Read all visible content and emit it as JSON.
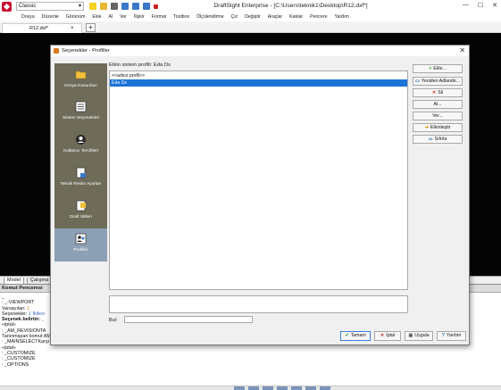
{
  "app": {
    "title": "DraftSight Enterprise - [C:\\Users\\teknik1\\Desktop\\R12.dxf*]",
    "workspace": "Classic",
    "window_controls": [
      "—",
      "☐",
      "✕"
    ]
  },
  "menu": {
    "items": [
      "Dosya",
      "Düzenle",
      "Görünüm",
      "Ekle",
      "Al",
      "Ver",
      "İlişkir",
      "Format",
      "Toolbox",
      "Ölçülendirme",
      "Çiz",
      "Değiştir",
      "Araçlar",
      "Katılar",
      "Pencere",
      "Yardım"
    ]
  },
  "tabs": {
    "document": "R12.dxf*",
    "close": "×",
    "new": "+"
  },
  "layout_tabs": {
    "model": "Model",
    "sheet": "Çalışma"
  },
  "command_window": {
    "title": "Komut Penceresi",
    "lines": [
      {
        "text": "_",
        "bold": false
      },
      {
        "text": ": _-VIEWPORT",
        "bold": false
      },
      {
        "text": "Varsayılan: ",
        "bold": false,
        "hl": "1"
      },
      {
        "text": "Seçenekler: ",
        "bold": false,
        "blue": "1 İkilesi"
      },
      {
        "text": "Seçenek belirtin: _",
        "bold": true
      },
      {
        "text": "«iptal»",
        "bold": false
      },
      {
        "text": "",
        "bold": false
      },
      {
        "text": ": _AM_REVISIONTA",
        "bold": false
      },
      {
        "text": "Tanınmayan komut AM_REVISIONTABLE: Yardım için, F1 düğsine basın.",
        "bold": false
      },
      {
        "text": ": _MAINSELECTKarşı köşeyi belirleyin.«iptal»",
        "bold": false
      },
      {
        "text": "«iptal»",
        "bold": false
      },
      {
        "text": ": _CUSTOMIZE",
        "bold": false
      },
      {
        "text": ": _CUSTOMIZE",
        "bold": false
      },
      {
        "text": "",
        "bold": false
      },
      {
        "text": ": _OPTIONS",
        "bold": false
      }
    ]
  },
  "dialog": {
    "title": "Seçenekler - Profiller",
    "close": "✕",
    "current_profile_label": "Etkin sistem profili:  Eda Ds",
    "nav": [
      {
        "label": "Dosya Konumları",
        "icon": "folder-icon"
      },
      {
        "label": "Sistem Seçenekleri",
        "icon": "system-options-icon"
      },
      {
        "label": "Kullanıcı Tercihleri",
        "icon": "user-preferences-icon"
      },
      {
        "label": "Teknik Resim Ayarları",
        "icon": "drawing-settings-icon"
      },
      {
        "label": "Draft Stilleri",
        "icon": "draft-styles-icon"
      },
      {
        "label": "Profiller",
        "icon": "profiles-icon",
        "selected": true
      }
    ],
    "profiles": [
      {
        "name": "<<adsız profil>>",
        "selected": false
      },
      {
        "name": "Eda Ds",
        "selected": true
      }
    ],
    "side_buttons": [
      {
        "label": "Ekle...",
        "icon": "+",
        "color": "#2e9e2e"
      },
      {
        "label": "Yeniden Adlandır...",
        "icon": "▭",
        "color": "#2d6db5"
      },
      {
        "label": "Sil",
        "icon": "✕",
        "color": "#d02020"
      },
      {
        "label": "Al...",
        "icon": "",
        "color": "#333333"
      },
      {
        "label": "Ver...",
        "icon": "",
        "color": "#333333"
      },
      {
        "label": "Etkinleştir",
        "icon": "➜",
        "color": "#e08a00"
      },
      {
        "label": "Sıfırla",
        "icon": "▭",
        "color": "#2d6db5"
      }
    ],
    "description_label": "Bul:",
    "buttons": {
      "ok": "Tamam",
      "cancel": "İptal",
      "apply": "Uygula",
      "help": "Yardım"
    },
    "button_icons": {
      "ok": "✔",
      "cancel": "✕",
      "apply": "▣",
      "help": "?"
    }
  },
  "colors": {
    "nav_bg": "#6f6b59",
    "nav_selected": "#8da0b4",
    "selection_blue": "#1a73d6",
    "brand_red": "#c8102e"
  }
}
